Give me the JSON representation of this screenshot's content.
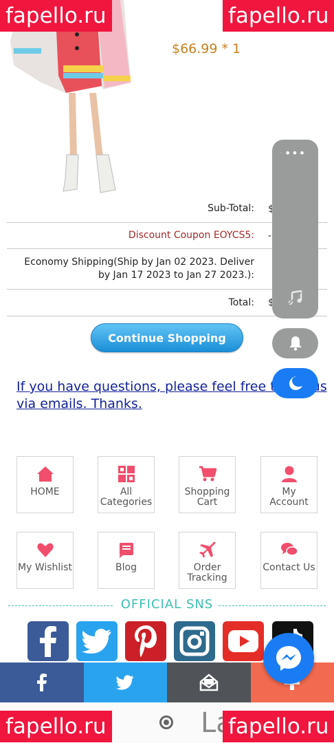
{
  "product": {
    "price": "$66.99 * 1"
  },
  "totals": {
    "subtotal_label": "Sub-Total:",
    "subtotal_value": "$",
    "coupon_label": "Discount Coupon EOYCS5:",
    "coupon_value": "-",
    "shipping_label": "Economy Shipping(Ship by Jan 02 2023. Deliver by Jan 17 2023 to Jan 27 2023.):",
    "total_label": "Total:",
    "total_value": "$"
  },
  "continue_label": "Continue Shopping",
  "questions_text": "If you have questions, please feel free to c… us via emails. Thanks.",
  "grid": [
    {
      "label": "HOME",
      "icon": "home-icon"
    },
    {
      "label": "All Categories",
      "icon": "categories-icon"
    },
    {
      "label": "Shopping Cart",
      "icon": "cart-icon"
    },
    {
      "label": "My Account",
      "icon": "account-icon"
    },
    {
      "label": "My Wishlist",
      "icon": "wishlist-icon"
    },
    {
      "label": "Blog",
      "icon": "blog-icon"
    },
    {
      "label": "Order Tracking",
      "icon": "plane-icon"
    },
    {
      "label": "Contact Us",
      "icon": "chat-icon"
    }
  ],
  "sns_title": "OFFICIAL SNS",
  "sns": [
    "facebook",
    "twitter",
    "pinterest",
    "instagram",
    "youtube",
    "tiktok"
  ],
  "share": [
    "facebook",
    "twitter",
    "email",
    "plus"
  ],
  "nav_text": "La",
  "watermark": "fapello.ru",
  "colors": {
    "accent_pink": "#f04e6c",
    "teal": "#3cbfb3",
    "link_blue": "#12229a",
    "watermark_red": "#f0163e"
  }
}
